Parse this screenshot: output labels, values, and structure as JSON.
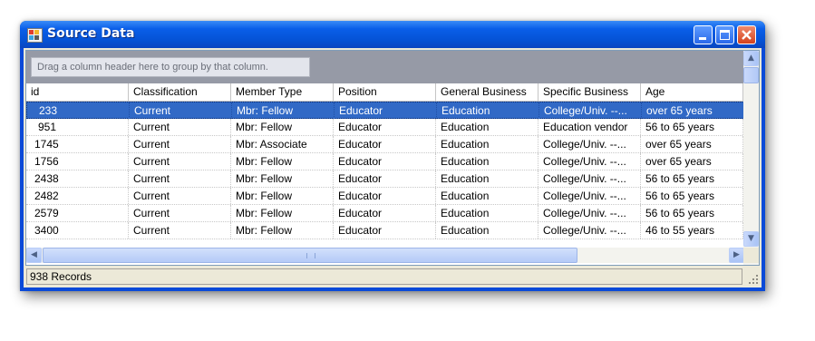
{
  "window": {
    "title": "Source Data",
    "icon": "datagrid-app-icon",
    "buttons": [
      "minimize",
      "maximize",
      "close"
    ]
  },
  "group_panel": {
    "hint": "Drag a column header here to group by that column."
  },
  "columns": [
    "id",
    "Classification",
    "Member Type",
    "Position",
    "General Business",
    "Specific Business",
    "Age"
  ],
  "rows": [
    [
      "233",
      "Current",
      "Mbr: Fellow",
      "Educator",
      "Education",
      "College/Univ. --...",
      "over 65 years"
    ],
    [
      "951",
      "Current",
      "Mbr: Fellow",
      "Educator",
      "Education",
      "Education vendor",
      "56 to 65 years"
    ],
    [
      "1745",
      "Current",
      "Mbr: Associate",
      "Educator",
      "Education",
      "College/Univ. --...",
      "over 65 years"
    ],
    [
      "1756",
      "Current",
      "Mbr: Fellow",
      "Educator",
      "Education",
      "College/Univ. --...",
      "over 65 years"
    ],
    [
      "2438",
      "Current",
      "Mbr: Fellow",
      "Educator",
      "Education",
      "College/Univ. --...",
      "56 to 65 years"
    ],
    [
      "2482",
      "Current",
      "Mbr: Fellow",
      "Educator",
      "Education",
      "College/Univ. --...",
      "56 to 65 years"
    ],
    [
      "2579",
      "Current",
      "Mbr: Fellow",
      "Educator",
      "Education",
      "College/Univ. --...",
      "56 to 65 years"
    ],
    [
      "3400",
      "Current",
      "Mbr: Fellow",
      "Educator",
      "Education",
      "College/Univ. --...",
      "46 to 55 years"
    ]
  ],
  "selected_row": 0,
  "status": {
    "text": "938 Records"
  },
  "colors": {
    "title_bar": "#0553d6",
    "selection": "#3169c6",
    "group_panel": "#969aa6"
  }
}
